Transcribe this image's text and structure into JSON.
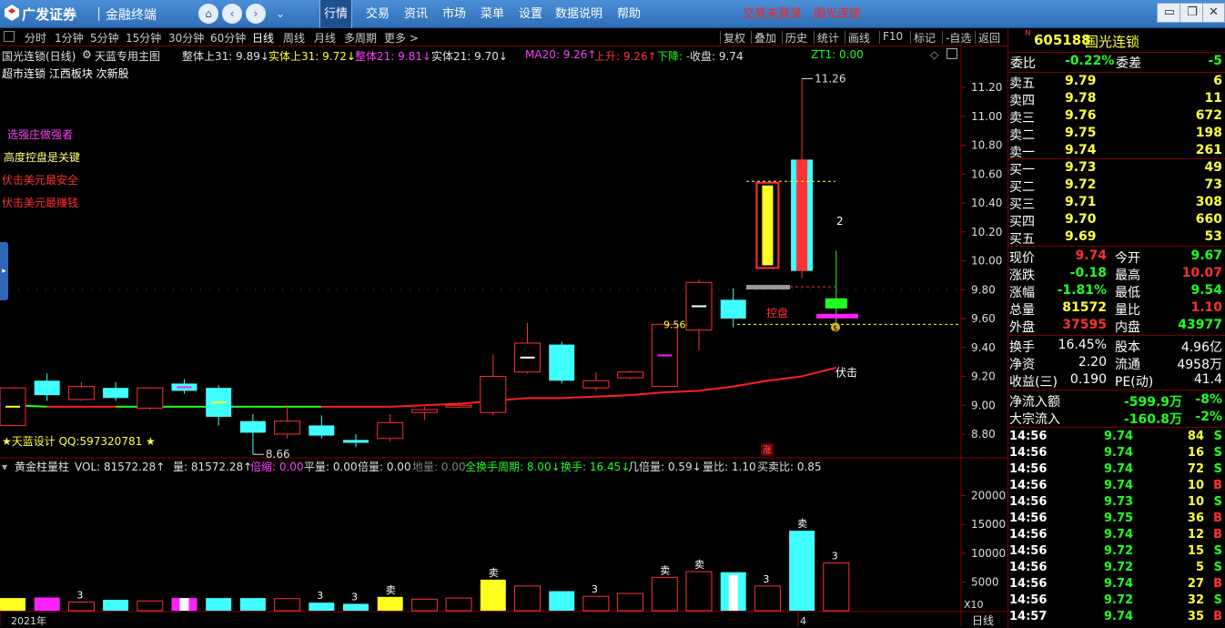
{
  "titlebar": {
    "brand1": "广发证券",
    "separator": "|",
    "brand2": "金融终端",
    "nav_icons": [
      "home-icon",
      "back-icon",
      "forward-icon",
      "collapse-icon"
    ],
    "menus": [
      "行情",
      "交易",
      "资讯",
      "市场",
      "菜单",
      "设置",
      "数据说明",
      "帮助"
    ],
    "active_menu": "行情",
    "trade_status": "交易未登录",
    "stock_name_link": "国光连锁",
    "window_buttons": [
      "▭",
      "❐",
      "✕"
    ]
  },
  "toolbar": {
    "periods": [
      "分时",
      "1分钟",
      "5分钟",
      "15分钟",
      "30分钟",
      "60分钟",
      "日线",
      "周线",
      "月线",
      "多周期",
      "更多 >"
    ],
    "active_period": "日线",
    "right_tools": [
      "复权",
      "叠加",
      "历史",
      "统计",
      "画线",
      "F10",
      "标记",
      "-自选",
      "返回"
    ]
  },
  "chart_header": {
    "title": "国光连锁(日线)",
    "formula": "天蓝专用主图",
    "indicators": [
      {
        "text": "整体上31: 9.89↓",
        "color": "#e0e0e0"
      },
      {
        "text": "实体上31: 9.72↓",
        "color": "#ffff40"
      },
      {
        "text": "整体21: 9.81↓",
        "color": "#ff40ff"
      },
      {
        "text": "实体21: 9.70↓",
        "color": "#e0e0e0"
      },
      {
        "text": "MA20: 9.26↑",
        "color": "#ff40ff"
      },
      {
        "text": "上升: 9.26↑",
        "color": "#ff3030"
      },
      {
        "text": "下降: -",
        "color": "#20ff20"
      },
      {
        "text": "收盘: 9.74",
        "color": "#e0e0e0"
      }
    ],
    "zt_label": "ZT1: 0.00",
    "concepts": "超市连锁 江西板块 次新股"
  },
  "notes": [
    {
      "text": "选强庄做强者",
      "color": "#ff40ff"
    },
    {
      "text": "高度控盘是关键",
      "color": "#ffff80"
    },
    {
      "text": "伏击美元最安全",
      "color": "#ff3030"
    },
    {
      "text": "伏击美元最赚钱",
      "color": "#ff3030"
    }
  ],
  "annotations": {
    "high_label": "11.26",
    "low_label": "8.66",
    "price_956": "9.56",
    "kongpan": "控盘",
    "fuji": "伏击",
    "num2": "2",
    "zhang": "涨",
    "footer_left": "★天蓝设计 QQ:597320781 ★",
    "year": "2021年",
    "month": "4",
    "period_label": "日线",
    "x10": "X10",
    "money_icon": "money-bag-icon"
  },
  "chart_data": {
    "type": "candlestick",
    "y_axis_ticks": [
      "11.20",
      "11.00",
      "10.80",
      "10.60",
      "10.40",
      "10.20",
      "10.00",
      "9.80",
      "9.60",
      "9.40",
      "9.20",
      "9.00",
      "8.80"
    ],
    "ylim": [
      8.7,
      11.3
    ],
    "candles": [
      {
        "o": 9.12,
        "h": 9.12,
        "l": 8.88,
        "c": 8.86,
        "color": "#ff3030"
      },
      {
        "o": 9.07,
        "h": 9.22,
        "l": 9.03,
        "c": 9.17,
        "color": "#40ffff"
      },
      {
        "o": 9.04,
        "h": 9.16,
        "l": 9.03,
        "c": 9.13,
        "color": "#ff3030"
      },
      {
        "o": 9.05,
        "h": 9.16,
        "l": 9.03,
        "c": 9.12,
        "color": "#40ffff"
      },
      {
        "o": 8.98,
        "h": 9.12,
        "l": 8.97,
        "c": 9.12,
        "color": "#ff3030"
      },
      {
        "o": 9.15,
        "h": 9.18,
        "l": 9.08,
        "c": 9.1,
        "color": "#40ffff"
      },
      {
        "o": 9.12,
        "h": 9.14,
        "l": 8.86,
        "c": 8.92,
        "color": "#40ffff"
      },
      {
        "o": 8.89,
        "h": 8.94,
        "l": 8.66,
        "c": 8.81,
        "color": "#40ffff"
      },
      {
        "o": 8.8,
        "h": 9.0,
        "l": 8.77,
        "c": 8.89,
        "color": "#ff3030"
      },
      {
        "o": 8.86,
        "h": 8.93,
        "l": 8.77,
        "c": 8.79,
        "color": "#40ffff"
      },
      {
        "o": 8.76,
        "h": 8.8,
        "l": 8.71,
        "c": 8.74,
        "color": "#40ffff"
      },
      {
        "o": 8.77,
        "h": 8.94,
        "l": 8.75,
        "c": 8.88,
        "color": "#ff3030"
      },
      {
        "o": 8.95,
        "h": 8.99,
        "l": 8.9,
        "c": 8.97,
        "color": "#ff3030"
      },
      {
        "o": 8.99,
        "h": 9.02,
        "l": 8.98,
        "c": 9.0,
        "color": "#ff3030"
      },
      {
        "o": 8.95,
        "h": 9.35,
        "l": 8.93,
        "c": 9.2,
        "color": "#ff3030"
      },
      {
        "o": 9.23,
        "h": 9.57,
        "l": 9.22,
        "c": 9.43,
        "color": "#ff3030"
      },
      {
        "o": 9.42,
        "h": 9.44,
        "l": 9.15,
        "c": 9.17,
        "color": "#40ffff"
      },
      {
        "o": 9.12,
        "h": 9.23,
        "l": 9.1,
        "c": 9.17,
        "color": "#ff3030"
      },
      {
        "o": 9.19,
        "h": 9.24,
        "l": 9.18,
        "c": 9.23,
        "color": "#ff3030"
      },
      {
        "o": 9.13,
        "h": 9.56,
        "l": 9.13,
        "c": 9.56,
        "color": "#ff3030"
      },
      {
        "o": 9.52,
        "h": 9.87,
        "l": 9.38,
        "c": 9.85,
        "color": "#ff3030"
      },
      {
        "o": 9.73,
        "h": 9.81,
        "l": 9.54,
        "c": 9.6,
        "color": "#40ffff"
      },
      {
        "o": 9.95,
        "h": 10.54,
        "l": 9.95,
        "c": 10.54,
        "color": "#ffff20"
      },
      {
        "o": 10.7,
        "h": 11.26,
        "l": 9.88,
        "c": 9.93,
        "color": "#ff3030"
      },
      {
        "o": 9.67,
        "h": 10.07,
        "l": 9.54,
        "c": 9.74,
        "color": "#20ff20"
      }
    ],
    "ma_line": [
      9.0,
      8.99,
      8.99,
      8.99,
      8.99,
      8.99,
      8.99,
      8.99,
      8.99,
      8.99,
      8.99,
      8.99,
      9.0,
      9.01,
      9.03,
      9.05,
      9.05,
      9.06,
      9.07,
      9.09,
      9.1,
      9.13,
      9.17,
      9.2,
      9.26
    ],
    "ma_colors": [
      "#20ff20",
      "#20ff20",
      "#ff2020",
      "#ff2020",
      "#20ff20",
      "#20ff20",
      "#20ff20",
      "#20ff20",
      "#20ff20",
      "#20ff20",
      "#ff2020",
      "#ff2020",
      "#ff2020",
      "#ff2020",
      "#ff2020",
      "#ff2020",
      "#ff2020",
      "#ff2020",
      "#ff2020",
      "#ff2020",
      "#ff2020",
      "#ff2020",
      "#ff2020",
      "#ff2020",
      "#ff2020"
    ],
    "volume": {
      "title": "黄金柱量柱",
      "indicators": [
        {
          "text": "VOL: 81572.28↑",
          "color": "#e0e0e0"
        },
        {
          "text": "量: 81572.28↑",
          "color": "#e0e0e0"
        },
        {
          "text": "倍缩: 0.00",
          "color": "#ff40ff"
        },
        {
          "text": "平量: 0.00",
          "color": "#e0e0e0"
        },
        {
          "text": "倍量: 0.00",
          "color": "#e0e0e0"
        },
        {
          "text": "地量: 0.00",
          "color": "#808080"
        },
        {
          "text": "全换手周期: 8.00↓",
          "color": "#20ff20"
        },
        {
          "text": "换手: 16.45↓",
          "color": "#20ff20"
        },
        {
          "text": "几倍量: 0.59↓",
          "color": "#e0e0e0"
        },
        {
          "text": "量比: 1.10",
          "color": "#e0e0e0"
        },
        {
          "text": "买卖比: 0.85",
          "color": "#e0e0e0"
        }
      ],
      "y_axis_ticks": [
        "20000",
        "15000",
        "10000",
        "5000"
      ],
      "ylim": [
        0,
        24000
      ],
      "values": [
        2200,
        2300,
        1500,
        1900,
        1700,
        2200,
        2200,
        2200,
        2100,
        1400,
        1200,
        2400,
        2000,
        2200,
        5400,
        4300,
        3400,
        2500,
        3000,
        5800,
        6800,
        6700,
        4300,
        13900,
        8300
      ],
      "colors": [
        "#ffff20",
        "#ff20ff",
        "#ff3030",
        "#40ffff",
        "#ff3030",
        "#ff20ff",
        "#40ffff",
        "#40ffff",
        "#ff3030",
        "#40ffff",
        "#40ffff",
        "#ffff20",
        "#ff3030",
        "#ff3030",
        "#ffff20",
        "#ff3030",
        "#40ffff",
        "#ff3030",
        "#ff3030",
        "#ff3030",
        "#ff3030",
        "#40ffff",
        "#ff3030",
        "#40ffff",
        "#ff3030"
      ],
      "labels": [
        "",
        "",
        "3",
        "",
        "",
        "",
        "",
        "",
        "",
        "3",
        "3",
        "卖",
        "",
        "",
        "卖",
        "",
        "",
        "3",
        "",
        "卖",
        "卖",
        "",
        "3",
        "卖",
        "3"
      ]
    }
  },
  "panel": {
    "code": "605188",
    "name": "国光连锁",
    "weibi_label": "委比",
    "weibi": "-0.22%",
    "weicha_label": "委差",
    "weicha": "-5",
    "asks": [
      {
        "label": "卖五",
        "price": "9.79",
        "vol": "6"
      },
      {
        "label": "卖四",
        "price": "9.78",
        "vol": "11"
      },
      {
        "label": "卖三",
        "price": "9.76",
        "vol": "672"
      },
      {
        "label": "卖二",
        "price": "9.75",
        "vol": "198"
      },
      {
        "label": "卖一",
        "price": "9.74",
        "vol": "261"
      }
    ],
    "bids": [
      {
        "label": "买一",
        "price": "9.73",
        "vol": "49"
      },
      {
        "label": "买二",
        "price": "9.72",
        "vol": "73"
      },
      {
        "label": "买三",
        "price": "9.71",
        "vol": "308"
      },
      {
        "label": "买四",
        "price": "9.70",
        "vol": "660"
      },
      {
        "label": "买五",
        "price": "9.69",
        "vol": "53"
      }
    ],
    "stats": [
      {
        "l1": "现价",
        "v1": "9.74",
        "c1": "#ff3030",
        "l2": "今开",
        "v2": "9.67",
        "c2": "#20ff20"
      },
      {
        "l1": "涨跌",
        "v1": "-0.18",
        "c1": "#20ff20",
        "l2": "最高",
        "v2": "10.07",
        "c2": "#ff3030"
      },
      {
        "l1": "涨幅",
        "v1": "-1.81%",
        "c1": "#20ff20",
        "l2": "最低",
        "v2": "9.54",
        "c2": "#20ff20"
      },
      {
        "l1": "总量",
        "v1": "81572",
        "c1": "#ffff40",
        "l2": "量比",
        "v2": "1.10",
        "c2": "#ff3030"
      },
      {
        "l1": "外盘",
        "v1": "37595",
        "c1": "#ff3030",
        "l2": "内盘",
        "v2": "43977",
        "c2": "#20ff20"
      }
    ],
    "stats2": [
      {
        "l1": "换手",
        "v1": "16.45%",
        "l2": "股本",
        "v2": "4.96亿"
      },
      {
        "l1": "净资",
        "v1": "2.20",
        "l2": "流通",
        "v2": "4958万"
      },
      {
        "l1": "收益(三)",
        "v1": "0.190",
        "l2": "PE(动)",
        "v2": "41.4"
      }
    ],
    "flows": [
      {
        "label": "净流入额",
        "value": "-599.9万",
        "pct": "-8%"
      },
      {
        "label": "大宗流入",
        "value": "-160.8万",
        "pct": "-2%"
      }
    ],
    "ticks": [
      {
        "time": "14:56",
        "price": "9.74",
        "vol": "84",
        "side": "S"
      },
      {
        "time": "14:56",
        "price": "9.74",
        "vol": "16",
        "side": "S"
      },
      {
        "time": "14:56",
        "price": "9.74",
        "vol": "72",
        "side": "S"
      },
      {
        "time": "14:56",
        "price": "9.74",
        "vol": "10",
        "side": "B"
      },
      {
        "time": "14:56",
        "price": "9.73",
        "vol": "10",
        "side": "S"
      },
      {
        "time": "14:56",
        "price": "9.75",
        "vol": "36",
        "side": "B"
      },
      {
        "time": "14:56",
        "price": "9.74",
        "vol": "12",
        "side": "B"
      },
      {
        "time": "14:56",
        "price": "9.72",
        "vol": "15",
        "side": "S"
      },
      {
        "time": "14:56",
        "price": "9.72",
        "vol": "5",
        "side": "S"
      },
      {
        "time": "14:56",
        "price": "9.74",
        "vol": "27",
        "side": "B"
      },
      {
        "time": "14:56",
        "price": "9.72",
        "vol": "32",
        "side": "S"
      },
      {
        "time": "14:57",
        "price": "9.74",
        "vol": "35",
        "side": "B"
      }
    ]
  }
}
